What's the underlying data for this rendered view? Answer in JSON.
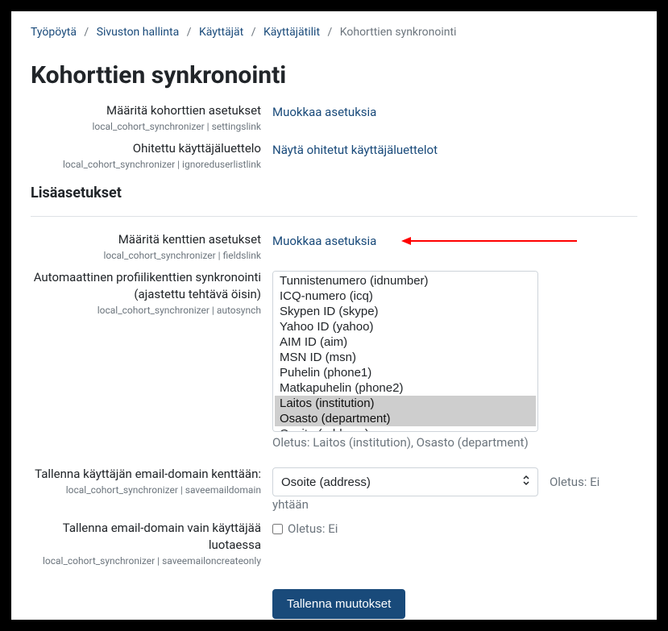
{
  "breadcrumb": {
    "items": [
      {
        "label": "Työpöytä"
      },
      {
        "label": "Sivuston hallinta"
      },
      {
        "label": "Käyttäjät"
      },
      {
        "label": "Käyttäjätilit"
      }
    ],
    "current": "Kohorttien synkronointi"
  },
  "page_title": "Kohorttien synkronointi",
  "settings": {
    "settings_link": {
      "label": "Määritä kohorttien asetukset",
      "key": "local_cohort_synchronizer | settingslink",
      "action": "Muokkaa asetuksia"
    },
    "ignored_list": {
      "label": "Ohitettu käyttäjäluettelo",
      "key": "local_cohort_synchronizer | ignoreduserlistlink",
      "action": "Näytä ohitetut käyttäjäluettelot"
    }
  },
  "advanced_heading": "Lisäasetukset",
  "fields_link": {
    "label": "Määritä kenttien asetukset",
    "key": "local_cohort_synchronizer | fieldslink",
    "action": "Muokkaa asetuksia"
  },
  "autosynch": {
    "label": "Automaattinen profiilikenttien synkronointi (ajastettu tehtävä öisin)",
    "key": "local_cohort_synchronizer | autosynch",
    "options": [
      {
        "text": "Tunnistenumero (idnumber)",
        "selected": false
      },
      {
        "text": "ICQ-numero (icq)",
        "selected": false
      },
      {
        "text": "Skypen ID (skype)",
        "selected": false
      },
      {
        "text": "Yahoo ID (yahoo)",
        "selected": false
      },
      {
        "text": "AIM ID (aim)",
        "selected": false
      },
      {
        "text": "MSN ID (msn)",
        "selected": false
      },
      {
        "text": "Puhelin (phone1)",
        "selected": false
      },
      {
        "text": "Matkapuhelin (phone2)",
        "selected": false
      },
      {
        "text": "Laitos (institution)",
        "selected": true
      },
      {
        "text": "Osasto (department)",
        "selected": true
      },
      {
        "text": "Osoite (address)",
        "selected": false
      }
    ],
    "default_text": "Oletus: Laitos (institution), Osasto (department)"
  },
  "save_email_domain": {
    "label": "Tallenna käyttäjän email-domain kenttään:",
    "key": "local_cohort_synchronizer | saveemaildomain",
    "selected": "Osoite (address)",
    "default_text": "Oletus: Ei yhtään"
  },
  "save_email_on_create_only": {
    "label": "Tallenna email-domain vain käyttäjää luotaessa",
    "key": "local_cohort_synchronizer | saveemailoncreateonly",
    "default_text": "Oletus: Ei",
    "checked": false
  },
  "save_button": "Tallenna muutokset"
}
